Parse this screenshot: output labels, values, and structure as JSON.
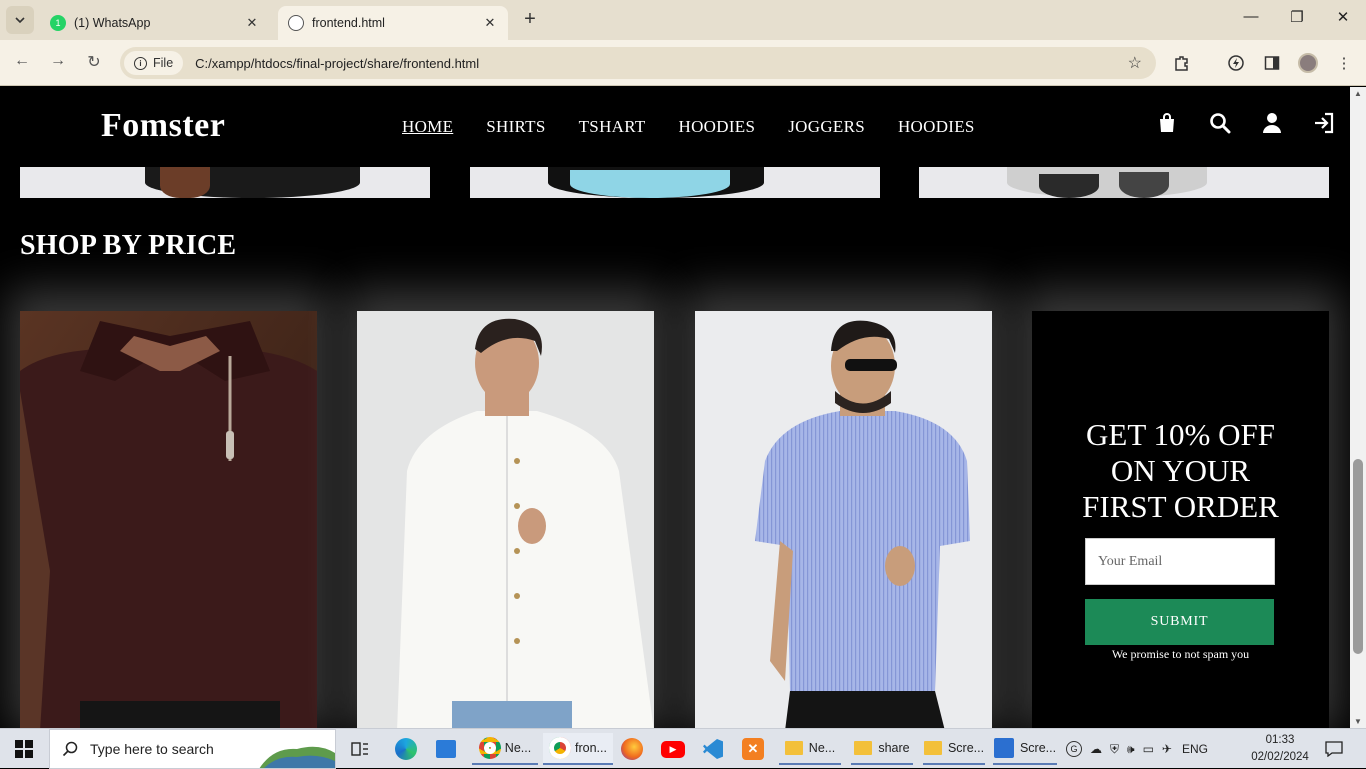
{
  "browser": {
    "tabs": [
      {
        "title": "(1) WhatsApp",
        "active": false
      },
      {
        "title": "frontend.html",
        "active": true
      }
    ],
    "address": {
      "chip_label": "File",
      "url": "C:/xampp/htdocs/final-project/share/frontend.html"
    }
  },
  "site": {
    "logo": "Fomster",
    "nav": [
      "HOME",
      "SHIRTS",
      "TSHART",
      "HOODIES",
      "JOGGERS",
      "HOODIES"
    ],
    "section_title_light": "SHOP BY ",
    "section_title_bold": "PRICE",
    "products": [
      {
        "alt": "brown zip polo shirt",
        "shirt_color": "#3a1818",
        "bg": "#4a2b1e"
      },
      {
        "alt": "white button shirt",
        "shirt_color": "#f4f4f1",
        "bg": "#e5e6e6"
      },
      {
        "alt": "blue striped short sleeve shirt",
        "shirt_color": "#9fb2e0",
        "bg": "#ebecef"
      }
    ],
    "promo": {
      "heading_lines": [
        "GET 10% OFF",
        "ON YOUR",
        "FIRST ORDER"
      ],
      "email_placeholder": "Your Email",
      "submit_label": "SUBMIT",
      "note": "We promise to not spam you"
    }
  },
  "taskbar": {
    "search_placeholder": "Type here to search",
    "apps": [
      {
        "label": "Ne...",
        "icon": "chrome-icon"
      },
      {
        "label": "fron...",
        "icon": "chrome-icon"
      },
      {
        "label": "Ne...",
        "icon": "folder-icon"
      },
      {
        "label": "share",
        "icon": "folder-icon"
      },
      {
        "label": "Scre...",
        "icon": "folder-icon"
      },
      {
        "label": "Scre...",
        "icon": "paint-icon"
      }
    ],
    "language": "ENG",
    "time": "01:33",
    "date": "02/02/2024"
  }
}
